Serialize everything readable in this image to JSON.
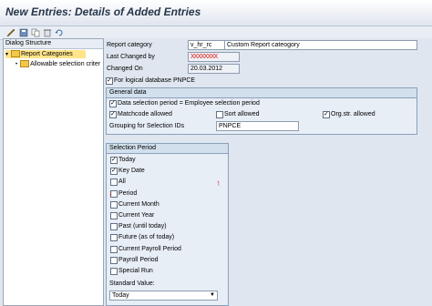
{
  "title": "New Entries: Details of Added Entries",
  "dialog_structure": {
    "header": "Dialog Structure",
    "items": [
      "Report Categories",
      "Allowable selection criter"
    ]
  },
  "fields": {
    "report_category_label": "Report category",
    "report_category_code": "v_hr_rc",
    "report_category_desc": "Custom Report cateogory",
    "last_changed_by_label": "Last Changed by",
    "last_changed_by_value": "XXXXXXXX",
    "changed_on_label": "Changed On",
    "changed_on_value": "20.03.2012",
    "logical_db_label": "For logical database PNPCE"
  },
  "general_data": {
    "title": "General data",
    "data_selection_label": "Data selection period = Employee selection period",
    "matchcode_label": "Matchcode allowed",
    "sort_label": "Sort allowed",
    "orgstr_label": "Org.str. allowed",
    "grouping_label": "Grouping for Selection IDs",
    "grouping_value": "PNPCE"
  },
  "selection_period": {
    "title": "Selection Period",
    "options": [
      {
        "label": "Today",
        "checked": true
      },
      {
        "label": "Key Date",
        "checked": true
      },
      {
        "label": "All",
        "checked": false
      },
      {
        "label": "Period",
        "checked": false
      },
      {
        "label": "Current Month",
        "checked": false
      },
      {
        "label": "Current Year",
        "checked": false
      },
      {
        "label": "Past (until today)",
        "checked": false
      },
      {
        "label": "Future (as of today)",
        "checked": false
      },
      {
        "label": "Current Payroll Period",
        "checked": false
      },
      {
        "label": "Payroll Period",
        "checked": false
      },
      {
        "label": "Special Run",
        "checked": false
      }
    ],
    "standard_value_label": "Standard Value:",
    "standard_value": "Today"
  },
  "checks": {
    "logical_db": true,
    "data_selection": true,
    "matchcode": true,
    "sort": false,
    "orgstr": true
  },
  "colors": {
    "selection_highlight": "#ffe48a",
    "redaction": "#d11"
  }
}
